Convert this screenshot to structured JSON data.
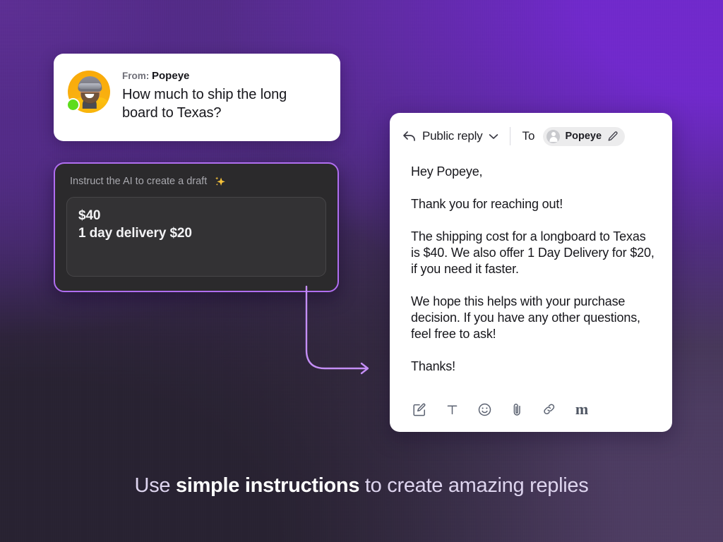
{
  "background": {
    "top_left_color": "#5b2d91",
    "top_right_color": "#6d28ca",
    "bottom_left_color": "#272130",
    "bottom_right_color": "#4a3a5e"
  },
  "message_card": {
    "from_label": "From:",
    "sender_name": "Popeye",
    "body": "How much to ship the long board to Texas?",
    "avatar_name": "popeye-avatar",
    "status": "online",
    "status_color": "#5ddc1c"
  },
  "ai_panel": {
    "header": "Instruct the AI to create a draft",
    "sparkle_icon": "sparkles-icon",
    "border_color": "#b06ef0",
    "instruction_lines": [
      "$40",
      "1 day delivery $20"
    ]
  },
  "connector": {
    "color": "#c48ef5",
    "arrow_direction": "right"
  },
  "reply_panel": {
    "reply_icon": "reply-arrow-icon",
    "reply_type": "Public reply",
    "chevron_icon": "chevron-down-icon",
    "to_label": "To",
    "recipient": "Popeye",
    "recipient_avatar_icon": "user-avatar-icon",
    "edit_recipient_icon": "pencil-icon",
    "paragraphs": [
      "Hey Popeye,",
      "Thank you for reaching out!",
      "The shipping cost for a longboard to Texas is $40. We also offer 1 Day Delivery for $20, if you need it faster.",
      "We hope this helps with your purchase decision. If you have any other questions, feel free to ask!",
      "Thanks!"
    ],
    "toolbar": [
      {
        "name": "compose-icon",
        "label": "Compose"
      },
      {
        "name": "text-format-icon",
        "label": "T"
      },
      {
        "name": "emoji-icon",
        "label": "Emoji"
      },
      {
        "name": "attachment-icon",
        "label": "Attach"
      },
      {
        "name": "link-icon",
        "label": "Link"
      },
      {
        "name": "markdown-icon",
        "label": "m"
      }
    ]
  },
  "caption": {
    "prefix": "Use ",
    "highlight": "simple instructions",
    "suffix": " to create amazing replies"
  }
}
